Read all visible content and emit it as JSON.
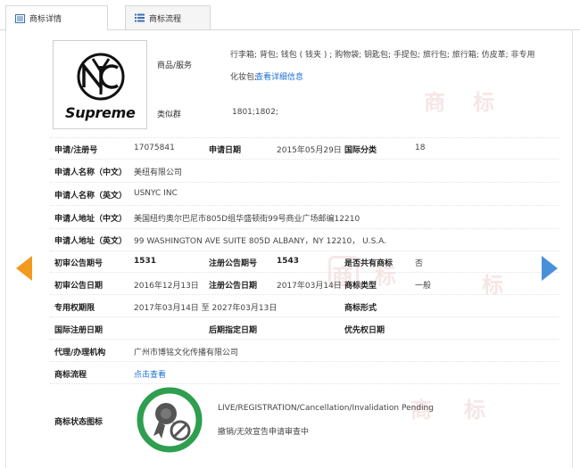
{
  "tabs": [
    {
      "label": "商标详情",
      "icon": "document-icon",
      "active": true
    },
    {
      "label": "商标流程",
      "icon": "list-icon",
      "active": false
    }
  ],
  "logo": {
    "text": "Supreme"
  },
  "goods": {
    "label": "商品/服务",
    "line1": "行李箱; 背包; 钱包 ( 钱夹 ) ; 购物袋; 钥匙包; 手提包; 旅行包; 旅行箱; 仿皮革; 非专用",
    "line2": "化妆包;",
    "link": "查看详细信息"
  },
  "similar": {
    "label": "类似群",
    "value": "1801;1802;"
  },
  "fields": {
    "reg_no_label": "申请/注册号",
    "reg_no": "17075841",
    "apply_date_label": "申请日期",
    "apply_date": "2015年05月29日",
    "intl_class_label": "国际分类",
    "intl_class": "18",
    "applicant_cn_label": "申请人名称（中文）",
    "applicant_cn": "美纽有限公司",
    "applicant_en_label": "申请人名称（英文）",
    "applicant_en": "USNYC INC",
    "address_cn_label": "申请人地址（中文）",
    "address_cn": "美国纽约奥尔巴尼市805D组华盛顿街99号商业广场邮编12210",
    "address_en_label": "申请人地址（英文）",
    "address_en": "99 WASHINGTON AVE SUITE 805D ALBANY，NY 12210， U.S.A.",
    "prelim_no_label": "初审公告期号",
    "prelim_no": "1531",
    "reg_pub_no_label": "注册公告期号",
    "reg_pub_no": "1543",
    "shared_label": "是否共有商标",
    "shared": "否",
    "prelim_date_label": "初审公告日期",
    "prelim_date": "2016年12月13日",
    "reg_pub_date_label": "注册公告日期",
    "reg_pub_date": "2017年03月14日",
    "tm_type_label": "商标类型",
    "tm_type": "一般",
    "exclusive_label": "专用权期限",
    "exclusive": "2017年03月14日 至 2027年03月13日",
    "tm_form_label": "商标形式",
    "intl_reg_date_label": "国际注册日期",
    "later_date_label": "后期指定日期",
    "priority_date_label": "优先权日期",
    "agent_label": "代理/办理机构",
    "agent": "广州市博铭文化传播有限公司",
    "flow_label": "商标流程",
    "flow_link": "点击查看",
    "status_label": "商标状态图标",
    "status_en": "LIVE/REGISTRATION/Cancellation/Invalidation Pending",
    "status_cn": "撤销/无效宣告申请审查中"
  },
  "nav": {
    "prev_icon": "arrow-left-icon",
    "next_icon": "arrow-right-icon"
  },
  "colors": {
    "link": "#1c6fd6",
    "prev_arrow": "#f29a1e",
    "next_arrow": "#4a90d9",
    "badge_ring": "#2e9e4f",
    "badge_fill": "#555555"
  }
}
